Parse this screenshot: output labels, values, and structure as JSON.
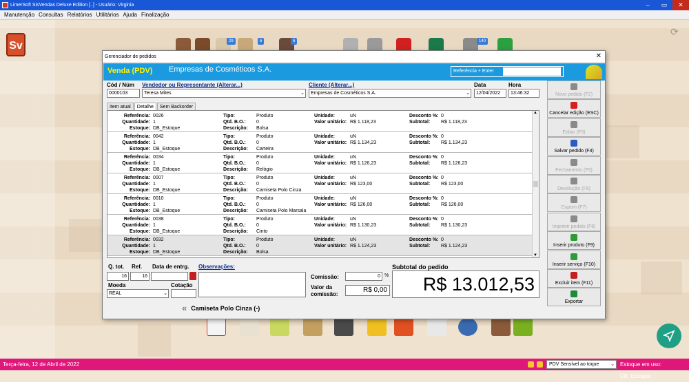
{
  "window": {
    "title": "LimerSoft SisVendas Deluxe Edition [..] - Usuário: Virginia"
  },
  "menu": [
    "Manutenção",
    "Consultas",
    "Relatórios",
    "Utilitários",
    "Ajuda",
    "Finalização"
  ],
  "logo": "Sv",
  "badges": [
    "29",
    "6",
    "6",
    "140"
  ],
  "dialog": {
    "title": "Gerenciador de pedidos",
    "close": "✕",
    "banner": {
      "mode": "Venda (PDV)",
      "company": "Empresas de Cosméticos S.A.",
      "ref_label": "Referência + Enter",
      "ref_value": ""
    },
    "fields": {
      "cod_label": "Cód / Núm",
      "cod_value": "0000103",
      "vendedor_label": "Vendedor ou Representante (Alterar...)",
      "vendedor_value": "Teresa Mites",
      "cliente_label": "Cliente (Alterar...)",
      "cliente_value": "Empresas de Cosméticos S.A.",
      "data_label": "Data",
      "data_value": "12/04/2022",
      "hora_label": "Hora",
      "hora_value": "13:46:32"
    },
    "tabs": [
      "Item atual",
      "Detalhe",
      "Sem Backorder"
    ],
    "labels": {
      "ref": "Referência:",
      "qtd": "Quantidade:",
      "est": "Estoque:",
      "tipo": "Tipo:",
      "qbo": "Qtd. B.O.:",
      "desc": "Descrição:",
      "un": "Unidade:",
      "vu": "Valor unitário:",
      "dp": "Desconto %:",
      "sub": "Subtotal:"
    },
    "items": [
      {
        "ref": "0026",
        "qtd": "1",
        "estoque": "DB_Estoque",
        "tipo": "Produto",
        "qbo": "0",
        "desc": "Bolsa",
        "unidade": "uN",
        "valor": "R$ 1.118,23",
        "desconto": "0",
        "subtotal": "R$ 1.118,23"
      },
      {
        "ref": "0042",
        "qtd": "1",
        "estoque": "DB_Estoque",
        "tipo": "Produto",
        "qbo": "0",
        "desc": "Carteira",
        "unidade": "uN",
        "valor": "R$ 1.134,23",
        "desconto": "0",
        "subtotal": "R$ 1.134,23"
      },
      {
        "ref": "0034",
        "qtd": "1",
        "estoque": "DB_Estoque",
        "tipo": "Produto",
        "qbo": "0",
        "desc": "Relógio",
        "unidade": "uN",
        "valor": "R$ 1.126,23",
        "desconto": "0",
        "subtotal": "R$ 1.126,23"
      },
      {
        "ref": "0007",
        "qtd": "1",
        "estoque": "DB_Estoque",
        "tipo": "Produto",
        "qbo": "0",
        "desc": "Camiseta Polo Cinza",
        "unidade": "uN",
        "valor": "R$ 123,00",
        "desconto": "0",
        "subtotal": "R$ 123,00"
      },
      {
        "ref": "0010",
        "qtd": "1",
        "estoque": "DB_Estoque",
        "tipo": "Produto",
        "qbo": "0",
        "desc": "Camiseta Polo Marsala",
        "unidade": "uN",
        "valor": "R$ 126,00",
        "desconto": "0",
        "subtotal": "R$ 126,00"
      },
      {
        "ref": "0038",
        "qtd": "1",
        "estoque": "DB_Estoque",
        "tipo": "Produto",
        "qbo": "0",
        "desc": "Cinto",
        "unidade": "uN",
        "valor": "R$ 1.130,23",
        "desconto": "0",
        "subtotal": "R$ 1.130,23"
      },
      {
        "ref": "0032",
        "qtd": "1",
        "estoque": "DB_Estoque",
        "tipo": "Produto",
        "qbo": "0",
        "desc": "Bolsa",
        "unidade": "uN",
        "valor": "R$ 1.124,23",
        "desconto": "0",
        "subtotal": "R$ 1.124,23"
      }
    ],
    "side_buttons": [
      {
        "label": "Novo pedido (F2)",
        "enabled": false,
        "icon": "new-order-icon",
        "color": "#8a8a8a"
      },
      {
        "label": "Cancelar edição (ESC)",
        "enabled": true,
        "icon": "cancel-icon",
        "color": "#d42020"
      },
      {
        "label": "Editar (F3)",
        "enabled": false,
        "icon": "edit-icon",
        "color": "#8a8a8a"
      },
      {
        "label": "Salvar pedido (F4)",
        "enabled": true,
        "icon": "save-icon",
        "color": "#2a5bbf"
      },
      {
        "label": "Fechamento (F5)",
        "enabled": false,
        "icon": "close-order-icon",
        "color": "#8a8a8a"
      },
      {
        "label": "Devolução (F6)",
        "enabled": false,
        "icon": "return-icon",
        "color": "#8a8a8a"
      },
      {
        "label": "Cupom (F7)",
        "enabled": false,
        "icon": "coupon-icon",
        "color": "#8a8a8a"
      },
      {
        "label": "Imprimir pedido (F8)",
        "enabled": false,
        "icon": "printer-icon",
        "color": "#8a8a8a"
      },
      {
        "label": "Inserir produto (F9)",
        "enabled": true,
        "icon": "add-product-icon",
        "color": "#2e9a3a"
      },
      {
        "label": "Inserir serviço (F10)",
        "enabled": true,
        "icon": "add-service-icon",
        "color": "#2e9a3a"
      },
      {
        "label": "Excluir item (F11)",
        "enabled": true,
        "icon": "delete-item-icon",
        "color": "#c42020"
      },
      {
        "label": "Exportar",
        "enabled": true,
        "icon": "export-icon",
        "color": "#1e8a3a"
      }
    ],
    "summary": {
      "qtot_label": "Q. tot.",
      "qtot_value": "16",
      "ref_label": "Ref.",
      "ref_value": "16",
      "entrega_label": "Data de entrg.",
      "entrega_value": "",
      "obs_label": "Observações:",
      "moeda_label": "Moeda",
      "moeda_value": "REAL",
      "cotacao_label": "Cotação",
      "cotacao_value": "",
      "comissao_label": "Comissão:",
      "comissao_value": "0",
      "comissao_unit": "%",
      "valor_comissao_label_1": "Valor da",
      "valor_comissao_label_2": "comissão:",
      "valor_comissao_value": "R$ 0,00",
      "subtotal_label": "Subtotal do pedido",
      "subtotal_value": "R$ 13.012,53"
    },
    "footer_item": "Camiseta Polo Cinza (-)"
  },
  "status": {
    "date": "Terça-feira, 12 de Abril de 2022",
    "pdv": "PDV Sensível ao toque",
    "stock": "Estoque em uso: DB_Estoque"
  }
}
